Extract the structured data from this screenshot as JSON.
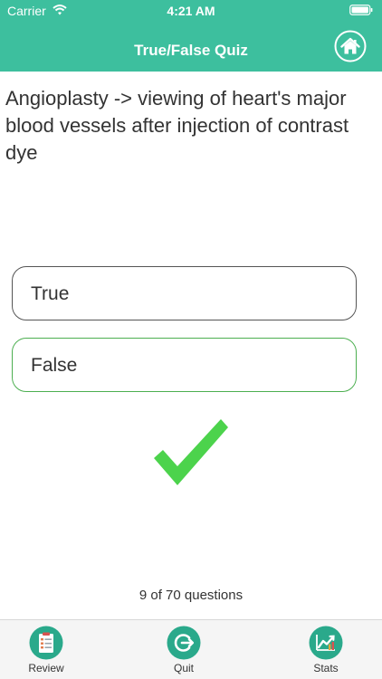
{
  "status_bar": {
    "carrier": "Carrier",
    "time": "4:21 AM"
  },
  "nav": {
    "title": "True/False Quiz",
    "home_icon": "home-icon"
  },
  "question": {
    "text": "Angioplasty -> viewing of heart's major blood vessels after injection of contrast dye"
  },
  "options": [
    {
      "label": "True",
      "border_color": "#555555"
    },
    {
      "label": "False",
      "border_color": "#4caf50"
    }
  ],
  "feedback": {
    "icon": "checkmark-icon",
    "color": "#4cd34c"
  },
  "progress": {
    "text": "9 of 70 questions",
    "current": 9,
    "total": 70
  },
  "tabbar": {
    "items": [
      {
        "label": "Review",
        "icon": "clipboard-icon"
      },
      {
        "label": "Quit",
        "icon": "exit-icon"
      },
      {
        "label": "Stats",
        "icon": "chart-icon"
      }
    ]
  },
  "colors": {
    "accent": "#3dbf9e",
    "tab_icon": "#2aa98b"
  }
}
